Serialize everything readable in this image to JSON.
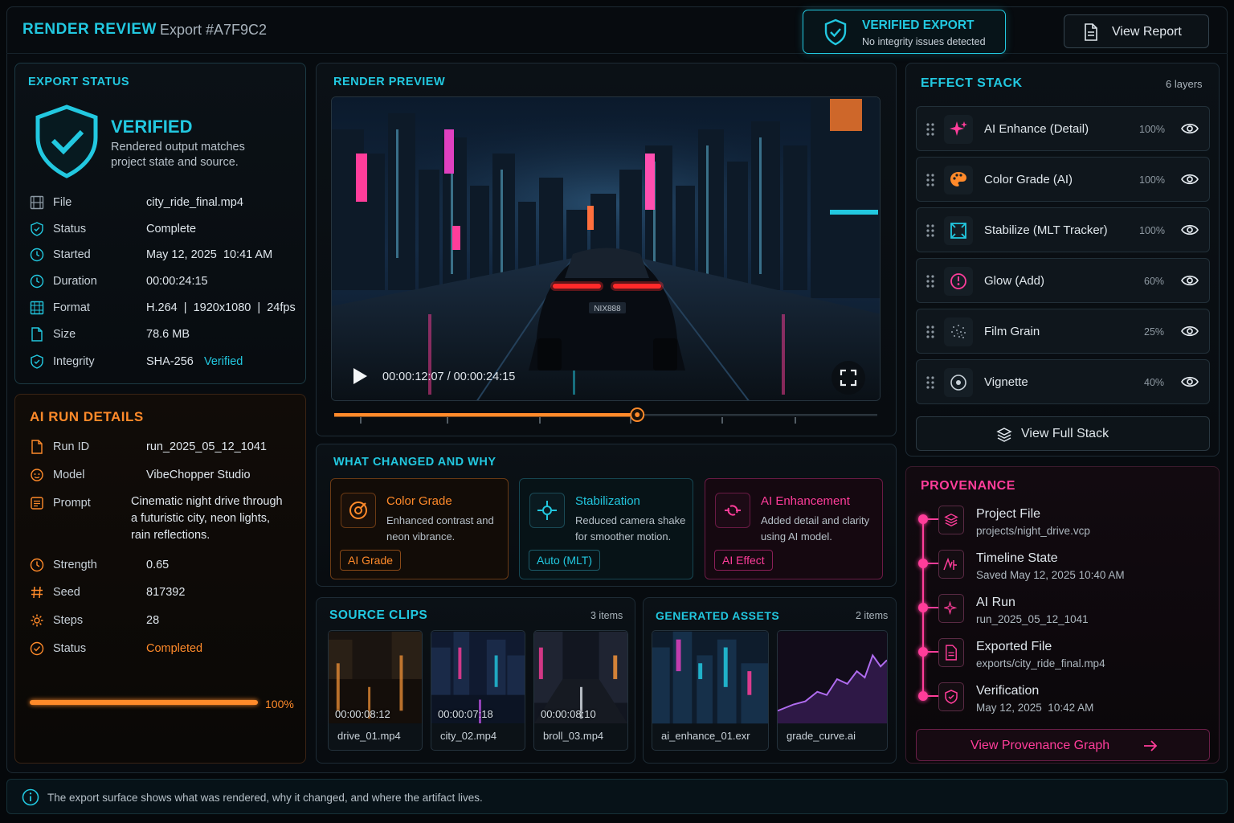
{
  "header": {
    "app_title": "RENDER REVIEW",
    "export_id": "Export #A7F9C2",
    "badge_title": "VERIFIED EXPORT",
    "badge_sub": "No integrity issues detected",
    "report_button": "View Report"
  },
  "export_status": {
    "title": "EXPORT STATUS",
    "state": "VERIFIED",
    "desc_line1": "Rendered output matches",
    "desc_line2": "project state and source.",
    "rows": [
      {
        "label": "File",
        "value": "city_ride_final.mp4"
      },
      {
        "label": "Status",
        "value": "Complete"
      },
      {
        "label": "Started",
        "value": "May 12, 2025  10:41 AM"
      },
      {
        "label": "Duration",
        "value": "00:00:24:15"
      },
      {
        "label": "Format",
        "value": "H.264  |  1920x1080  |  24fps"
      },
      {
        "label": "Size",
        "value": "78.6 MB"
      },
      {
        "label": "Integrity",
        "value": "SHA-256",
        "extra": "Verified"
      }
    ]
  },
  "ai_run": {
    "title": "AI RUN DETAILS",
    "rows": [
      {
        "label": "Run ID",
        "value": "run_2025_05_12_1041"
      },
      {
        "label": "Model",
        "value": "VibeChopper Studio"
      },
      {
        "label": "Prompt",
        "value_lines": [
          "Cinematic night drive through",
          "a futuristic city, neon lights,",
          "rain reflections."
        ]
      },
      {
        "label": "Strength",
        "value": "0.65"
      },
      {
        "label": "Seed",
        "value": "817392"
      },
      {
        "label": "Steps",
        "value": "28"
      },
      {
        "label": "Status",
        "value": "Completed"
      }
    ],
    "progress": 1.0,
    "progress_label": "100%"
  },
  "preview": {
    "title": "RENDER PREVIEW",
    "timecode": "00:00:12:07 / 00:00:24:15",
    "plate": "NIX888",
    "progress": 0.558
  },
  "changes": {
    "title": "WHAT CHANGED AND WHY",
    "cards": [
      {
        "title": "Color Grade",
        "desc": "Enhanced contrast and neon vibrance.",
        "tag": "AI Grade"
      },
      {
        "title": "Stabilization",
        "desc": "Reduced camera shake for smoother motion.",
        "tag": "Auto (MLT)"
      },
      {
        "title": "AI Enhancement",
        "desc": "Added detail and clarity using AI model.",
        "tag": "AI Effect"
      }
    ]
  },
  "source_clips": {
    "title": "SOURCE CLIPS",
    "count": "3 items",
    "items": [
      {
        "time": "00:00:08:12",
        "name": "drive_01.mp4"
      },
      {
        "time": "00:00:07:18",
        "name": "city_02.mp4"
      },
      {
        "time": "00:00:08:10",
        "name": "broll_03.mp4"
      }
    ]
  },
  "generated_assets": {
    "title": "GENERATED ASSETS",
    "count": "2 items",
    "items": [
      {
        "name": "ai_enhance_01.exr"
      },
      {
        "name": "grade_curve.ai"
      }
    ]
  },
  "effect_stack": {
    "title": "EFFECT STACK",
    "count": "6 layers",
    "layers": [
      {
        "name": "AI Enhance (Detail)",
        "pct": "100%",
        "icon": "sparkle-icon"
      },
      {
        "name": "Color Grade (AI)",
        "pct": "100%",
        "icon": "palette-icon"
      },
      {
        "name": "Stabilize (MLT Tracker)",
        "pct": "100%",
        "icon": "stabilize-icon"
      },
      {
        "name": "Glow (Add)",
        "pct": "60%",
        "icon": "glow-icon"
      },
      {
        "name": "Film Grain",
        "pct": "25%",
        "icon": "grain-icon"
      },
      {
        "name": "Vignette",
        "pct": "40%",
        "icon": "vignette-icon"
      }
    ],
    "button": "View Full Stack"
  },
  "provenance": {
    "title": "PROVENANCE",
    "items": [
      {
        "title": "Project File",
        "sub": "projects/night_drive.vcp"
      },
      {
        "title": "Timeline State",
        "sub": "Saved May 12, 2025 10:40 AM"
      },
      {
        "title": "AI Run",
        "sub": "run_2025_05_12_1041"
      },
      {
        "title": "Exported File",
        "sub": "exports/city_ride_final.mp4"
      },
      {
        "title": "Verification",
        "sub": "May 12, 2025  10:42 AM"
      }
    ],
    "button": "View Provenance Graph"
  },
  "footer": {
    "text": "The export surface shows what was rendered, why it changed, and where the artifact lives."
  },
  "colors": {
    "cyan": "#22c8e0",
    "orange": "#ff8a2a",
    "pink": "#ff3d9a"
  }
}
